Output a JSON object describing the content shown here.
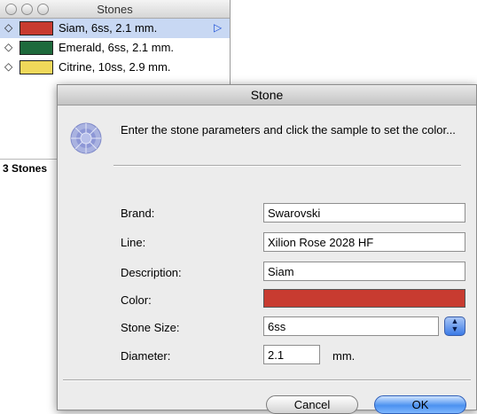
{
  "palette": {
    "title": "Stones",
    "stones": [
      {
        "label": "Siam, 6ss, 2.1 mm.",
        "color": "#c83b30",
        "selected": true
      },
      {
        "label": "Emerald, 6ss, 2.1 mm.",
        "color": "#1e6a3c",
        "selected": false
      },
      {
        "label": "Citrine, 10ss, 2.9 mm.",
        "color": "#f0d85a",
        "selected": false
      }
    ],
    "count_label": "3 Stones"
  },
  "dialog": {
    "title": "Stone",
    "intro": "Enter the stone parameters and click the sample to set the color...",
    "brand_label": "Brand:",
    "brand_value": "Swarovski",
    "line_label": "Line:",
    "line_value": "Xilion Rose 2028 HF",
    "description_label": "Description:",
    "description_value": "Siam",
    "color_label": "Color:",
    "color_value": "#c83b30",
    "stone_size_label": "Stone Size:",
    "stone_size_value": "6ss",
    "diameter_label": "Diameter:",
    "diameter_value": "2.1",
    "diameter_unit": "mm.",
    "cancel_label": "Cancel",
    "ok_label": "OK"
  }
}
